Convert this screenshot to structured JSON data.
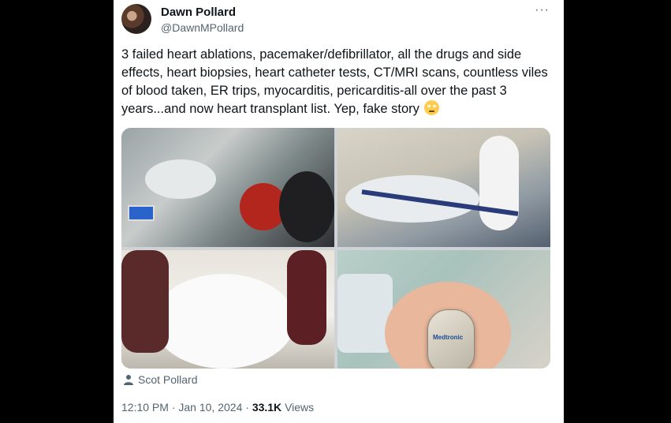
{
  "tweet": {
    "author_name": "Dawn Pollard",
    "author_handle": "@DawnMPollard",
    "more_label": "···",
    "text": "3 failed heart ablations, pacemaker/defibrillator, all the drugs and side effects, heart biopsies, heart catheter tests, CT/MRI scans, countless viles of blood taken, ER trips, myocarditis, pericarditis-all over the past 3 years...and now heart transplant list. Yep, fake story",
    "emoji": "face-with-rolling-eyes",
    "media": {
      "photo_count": 4,
      "device_brand": "Medtronic"
    },
    "tagged_user": "Scot Pollard",
    "time": "12:10 PM",
    "date": "Jan 10, 2024",
    "separator": "·",
    "views_count": "33.1K",
    "views_label": "Views"
  }
}
